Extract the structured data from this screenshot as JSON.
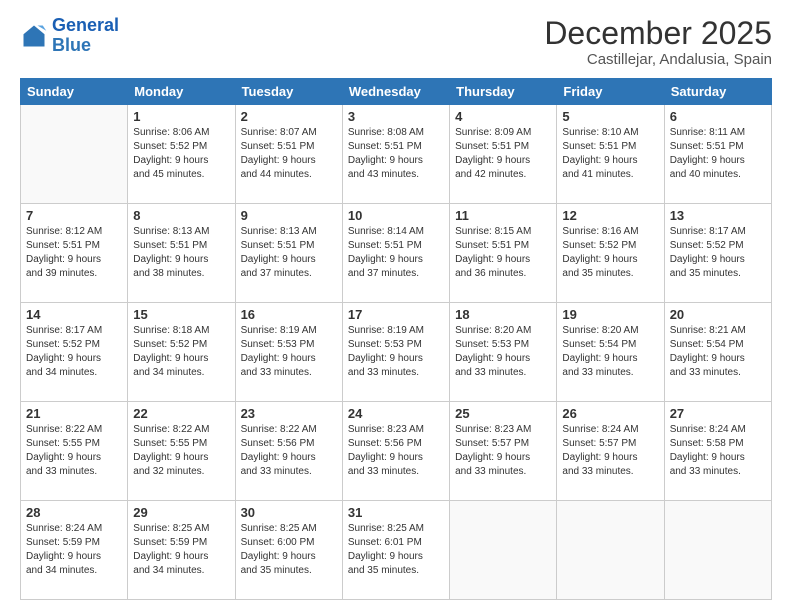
{
  "logo": {
    "line1": "General",
    "line2": "Blue"
  },
  "title": "December 2025",
  "subtitle": "Castillejar, Andalusia, Spain",
  "weekdays": [
    "Sunday",
    "Monday",
    "Tuesday",
    "Wednesday",
    "Thursday",
    "Friday",
    "Saturday"
  ],
  "weeks": [
    [
      {
        "day": "",
        "info": ""
      },
      {
        "day": "1",
        "info": "Sunrise: 8:06 AM\nSunset: 5:52 PM\nDaylight: 9 hours\nand 45 minutes."
      },
      {
        "day": "2",
        "info": "Sunrise: 8:07 AM\nSunset: 5:51 PM\nDaylight: 9 hours\nand 44 minutes."
      },
      {
        "day": "3",
        "info": "Sunrise: 8:08 AM\nSunset: 5:51 PM\nDaylight: 9 hours\nand 43 minutes."
      },
      {
        "day": "4",
        "info": "Sunrise: 8:09 AM\nSunset: 5:51 PM\nDaylight: 9 hours\nand 42 minutes."
      },
      {
        "day": "5",
        "info": "Sunrise: 8:10 AM\nSunset: 5:51 PM\nDaylight: 9 hours\nand 41 minutes."
      },
      {
        "day": "6",
        "info": "Sunrise: 8:11 AM\nSunset: 5:51 PM\nDaylight: 9 hours\nand 40 minutes."
      }
    ],
    [
      {
        "day": "7",
        "info": "Sunrise: 8:12 AM\nSunset: 5:51 PM\nDaylight: 9 hours\nand 39 minutes."
      },
      {
        "day": "8",
        "info": "Sunrise: 8:13 AM\nSunset: 5:51 PM\nDaylight: 9 hours\nand 38 minutes."
      },
      {
        "day": "9",
        "info": "Sunrise: 8:13 AM\nSunset: 5:51 PM\nDaylight: 9 hours\nand 37 minutes."
      },
      {
        "day": "10",
        "info": "Sunrise: 8:14 AM\nSunset: 5:51 PM\nDaylight: 9 hours\nand 37 minutes."
      },
      {
        "day": "11",
        "info": "Sunrise: 8:15 AM\nSunset: 5:51 PM\nDaylight: 9 hours\nand 36 minutes."
      },
      {
        "day": "12",
        "info": "Sunrise: 8:16 AM\nSunset: 5:52 PM\nDaylight: 9 hours\nand 35 minutes."
      },
      {
        "day": "13",
        "info": "Sunrise: 8:17 AM\nSunset: 5:52 PM\nDaylight: 9 hours\nand 35 minutes."
      }
    ],
    [
      {
        "day": "14",
        "info": "Sunrise: 8:17 AM\nSunset: 5:52 PM\nDaylight: 9 hours\nand 34 minutes."
      },
      {
        "day": "15",
        "info": "Sunrise: 8:18 AM\nSunset: 5:52 PM\nDaylight: 9 hours\nand 34 minutes."
      },
      {
        "day": "16",
        "info": "Sunrise: 8:19 AM\nSunset: 5:53 PM\nDaylight: 9 hours\nand 33 minutes."
      },
      {
        "day": "17",
        "info": "Sunrise: 8:19 AM\nSunset: 5:53 PM\nDaylight: 9 hours\nand 33 minutes."
      },
      {
        "day": "18",
        "info": "Sunrise: 8:20 AM\nSunset: 5:53 PM\nDaylight: 9 hours\nand 33 minutes."
      },
      {
        "day": "19",
        "info": "Sunrise: 8:20 AM\nSunset: 5:54 PM\nDaylight: 9 hours\nand 33 minutes."
      },
      {
        "day": "20",
        "info": "Sunrise: 8:21 AM\nSunset: 5:54 PM\nDaylight: 9 hours\nand 33 minutes."
      }
    ],
    [
      {
        "day": "21",
        "info": "Sunrise: 8:22 AM\nSunset: 5:55 PM\nDaylight: 9 hours\nand 33 minutes."
      },
      {
        "day": "22",
        "info": "Sunrise: 8:22 AM\nSunset: 5:55 PM\nDaylight: 9 hours\nand 32 minutes."
      },
      {
        "day": "23",
        "info": "Sunrise: 8:22 AM\nSunset: 5:56 PM\nDaylight: 9 hours\nand 33 minutes."
      },
      {
        "day": "24",
        "info": "Sunrise: 8:23 AM\nSunset: 5:56 PM\nDaylight: 9 hours\nand 33 minutes."
      },
      {
        "day": "25",
        "info": "Sunrise: 8:23 AM\nSunset: 5:57 PM\nDaylight: 9 hours\nand 33 minutes."
      },
      {
        "day": "26",
        "info": "Sunrise: 8:24 AM\nSunset: 5:57 PM\nDaylight: 9 hours\nand 33 minutes."
      },
      {
        "day": "27",
        "info": "Sunrise: 8:24 AM\nSunset: 5:58 PM\nDaylight: 9 hours\nand 33 minutes."
      }
    ],
    [
      {
        "day": "28",
        "info": "Sunrise: 8:24 AM\nSunset: 5:59 PM\nDaylight: 9 hours\nand 34 minutes."
      },
      {
        "day": "29",
        "info": "Sunrise: 8:25 AM\nSunset: 5:59 PM\nDaylight: 9 hours\nand 34 minutes."
      },
      {
        "day": "30",
        "info": "Sunrise: 8:25 AM\nSunset: 6:00 PM\nDaylight: 9 hours\nand 35 minutes."
      },
      {
        "day": "31",
        "info": "Sunrise: 8:25 AM\nSunset: 6:01 PM\nDaylight: 9 hours\nand 35 minutes."
      },
      {
        "day": "",
        "info": ""
      },
      {
        "day": "",
        "info": ""
      },
      {
        "day": "",
        "info": ""
      }
    ]
  ]
}
